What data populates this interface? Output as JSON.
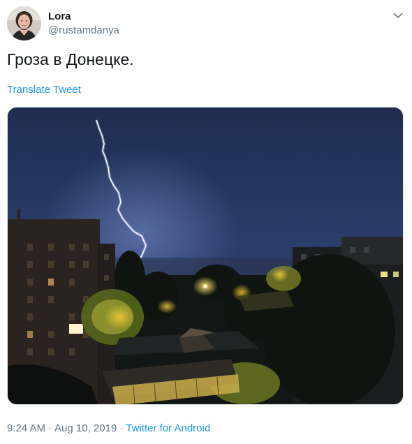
{
  "user": {
    "display_name": "Lora",
    "handle": "@rustamdanya",
    "avatar_icon": "user-avatar-photo"
  },
  "menu": {
    "icon": "chevron-down-icon"
  },
  "tweet": {
    "text": "Гроза в Донецке.",
    "translate_label": "Translate Tweet"
  },
  "media": {
    "icon": "photo-lightning-night-city"
  },
  "meta": {
    "time": "9:24 AM",
    "date": "Aug 10, 2019",
    "separator": "·",
    "source": "Twitter for Android"
  },
  "colors": {
    "link": "#1b95e0",
    "secondary_text": "#657786",
    "primary_text": "#14171a",
    "border": "#e1e8ed"
  }
}
